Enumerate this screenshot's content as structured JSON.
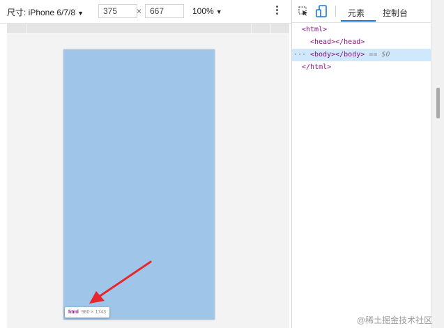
{
  "device_toolbar": {
    "device_label": "尺寸: iPhone 6/7/8",
    "width_value": "375",
    "times_sign": "×",
    "height_value": "667",
    "zoom_label": "100%"
  },
  "viewport": {
    "tooltip_tag": "html",
    "tooltip_size": "980 × 1743",
    "page_color": "#9fc5e8",
    "arrow_color": "#e8262d"
  },
  "devtools": {
    "tabs": [
      {
        "label": "元素",
        "active": true
      },
      {
        "label": "控制台",
        "active": false
      }
    ],
    "accent_color": "#1a73e8",
    "dom_tree": [
      {
        "text": "<html>",
        "selected": false
      },
      {
        "text": "<head></head>",
        "selected": false
      },
      {
        "text": "<body></body>",
        "suffix": " == $0",
        "selected": true
      },
      {
        "text": "</html>",
        "selected": false
      }
    ],
    "row_ellipsis": "···"
  },
  "watermark": "@稀土掘金技术社区"
}
